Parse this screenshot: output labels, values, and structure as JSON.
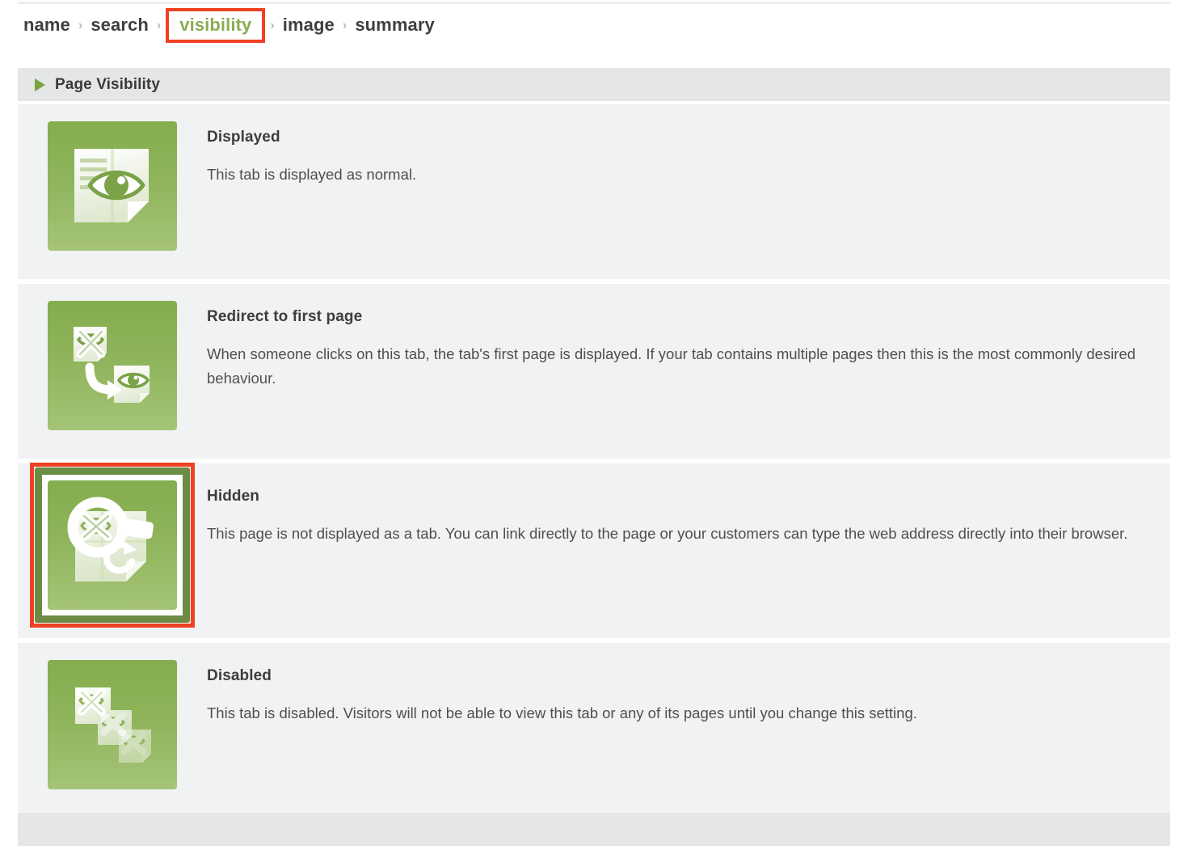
{
  "breadcrumb": {
    "separator": "›",
    "items": [
      {
        "label": "name",
        "active": false
      },
      {
        "label": "search",
        "active": false
      },
      {
        "label": "visibility",
        "active": true,
        "highlighted": true
      },
      {
        "label": "image",
        "active": false
      },
      {
        "label": "summary",
        "active": false
      }
    ]
  },
  "section": {
    "title": "Page Visibility",
    "toggle_icon": "triangle-right-icon",
    "expanded": true
  },
  "options": [
    {
      "id": "displayed",
      "title": "Displayed",
      "description": "This tab is displayed as normal.",
      "icon": "page-visible-eye-icon",
      "selected": false
    },
    {
      "id": "redirect",
      "title": "Redirect to first page",
      "description": "When someone clicks on this tab, the tab's first page is displayed. If your tab contains multiple pages then this is the most commonly desired behaviour.",
      "icon": "page-redirect-arrow-icon",
      "selected": false
    },
    {
      "id": "hidden",
      "title": "Hidden",
      "description": "This page is not displayed as a tab. You can link directly to the page or your customers can type the web address directly into their browser.",
      "icon": "page-hidden-magnifier-icon",
      "selected": true
    },
    {
      "id": "disabled",
      "title": "Disabled",
      "description": "This tab is disabled. Visitors will not be able to view this tab or any of its pages until you change this setting.",
      "icon": "pages-disabled-stack-icon",
      "selected": false
    }
  ],
  "colors": {
    "accent_green": "#8aad52",
    "tile_green_top": "#84ad4d",
    "tile_green_bottom": "#a5c477",
    "highlight_red": "#ef4123",
    "row_background": "#f1f2f3",
    "header_background": "#e5e6e6",
    "selected_border_green": "#6d8c43"
  }
}
